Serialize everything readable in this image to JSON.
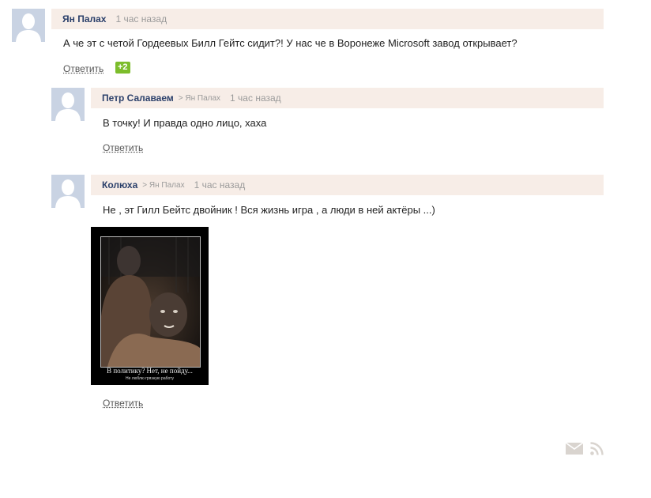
{
  "comments": [
    {
      "author": "Ян Палах",
      "reply_to": "",
      "time": "1 час назад",
      "text": "А че эт с четой Гордеевых Билл Гейтс сидит?! У нас че в Воронеже Microsoft завод открывает?",
      "reply_label": "Ответить",
      "rating": "+2"
    },
    {
      "author": "Петр Салаваем",
      "reply_to": "> Ян Палах",
      "time": "1 час назад",
      "text": "В точку! И правда одно лицо, хаха",
      "reply_label": "Ответить"
    },
    {
      "author": "Колюха",
      "reply_to": "> Ян Палах",
      "time": "1 час назад",
      "text": "Не , эт Гилл Бейтс двойник ! Вся жизнь игра , а люди в ней актёры ...)",
      "reply_label": "Ответить",
      "image": {
        "caption": "В политику? Нет, не пойду...",
        "subcaption": "Не люблю грязную работу"
      }
    }
  ],
  "footer": {
    "icons": [
      "mail-icon",
      "rss-icon"
    ]
  },
  "colors": {
    "header_bg": "#f7ede7",
    "author": "#2a3f6a",
    "rating_bg": "#7cbd2b",
    "avatar_bg": "#c9d3e3",
    "footer_icon": "#d9d4cf"
  }
}
